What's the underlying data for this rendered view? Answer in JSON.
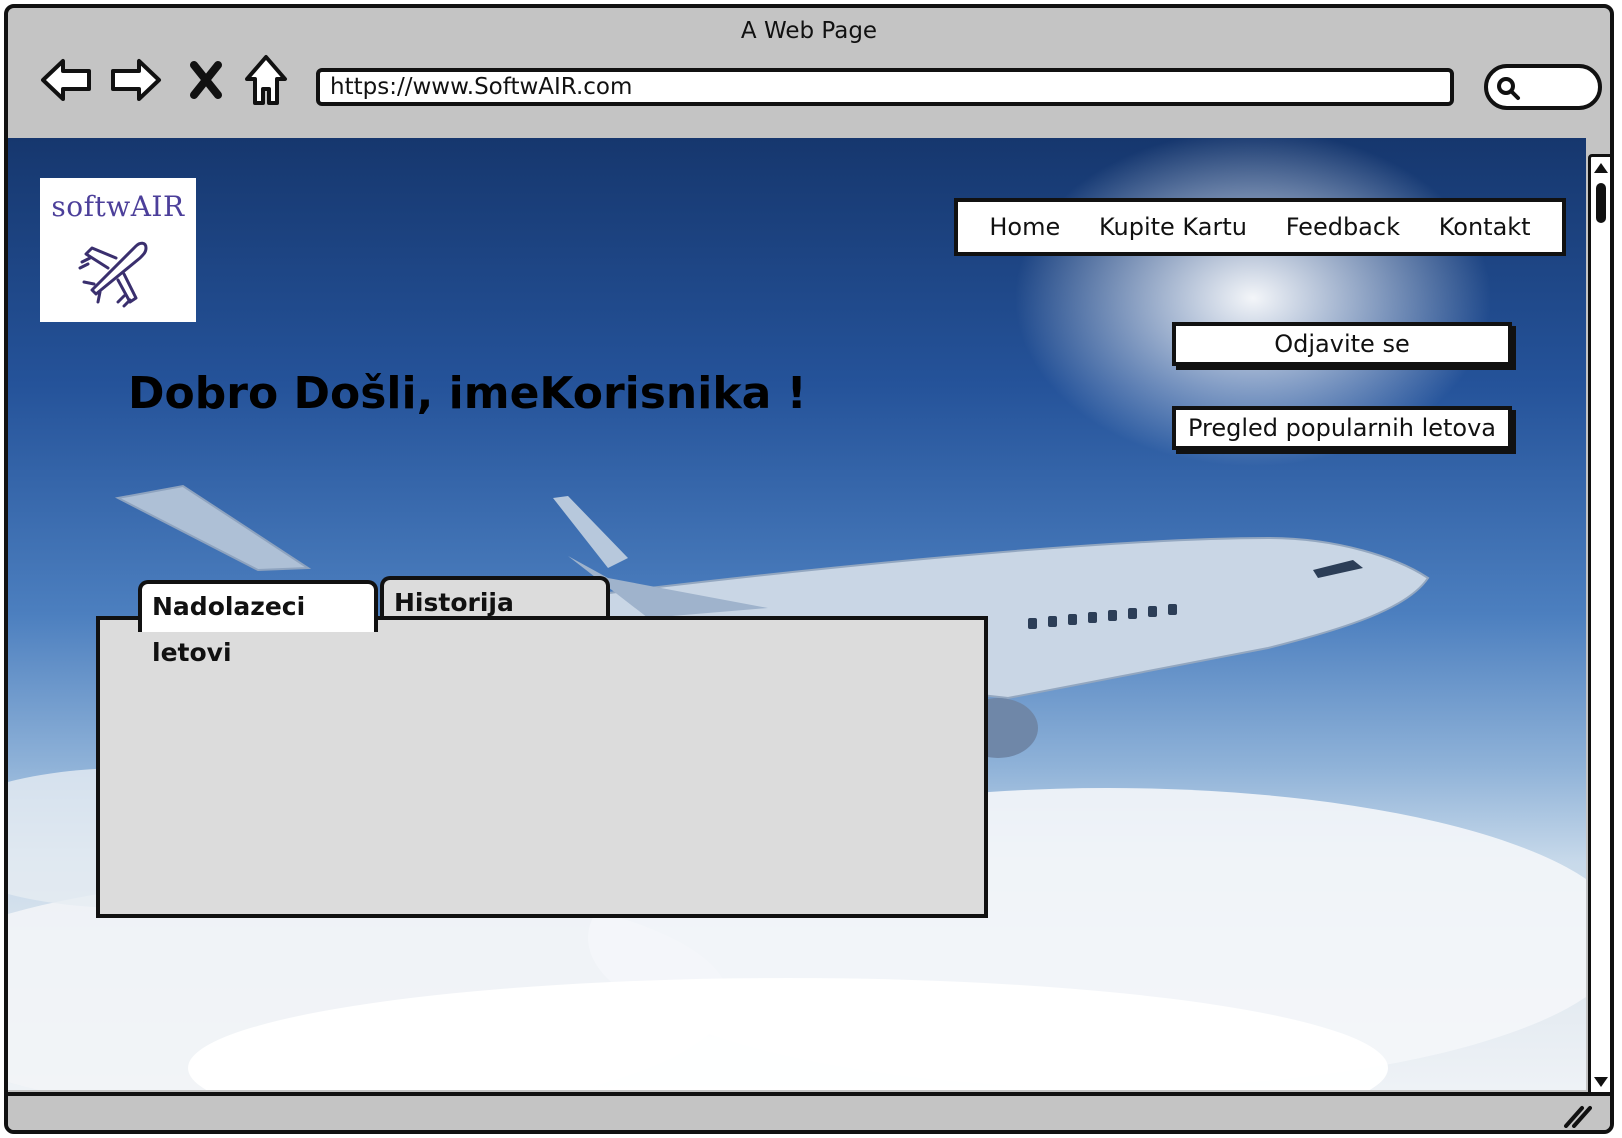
{
  "browser": {
    "title": "A Web Page",
    "url": "https://www.SoftwAIR.com"
  },
  "logo": {
    "text": "softwAIR"
  },
  "menu": {
    "items": [
      {
        "label": "Home"
      },
      {
        "label": "Kupite Kartu"
      },
      {
        "label": "Feedback"
      },
      {
        "label": "Kontakt"
      }
    ]
  },
  "actions": {
    "logout_label": "Odjavite se",
    "popular_label": "Pregled popularnih letova"
  },
  "welcome": "Dobro Došli, imeKorisnika !",
  "tabs": [
    {
      "label": "Nadolazeci letovi",
      "active": true
    },
    {
      "label": "Historija Letova",
      "active": false
    }
  ],
  "colors": {
    "chrome": "#c4c4c4",
    "sky_top": "#16376e",
    "panel": "#dcdcdc",
    "logo_text": "#4c3f9a"
  }
}
